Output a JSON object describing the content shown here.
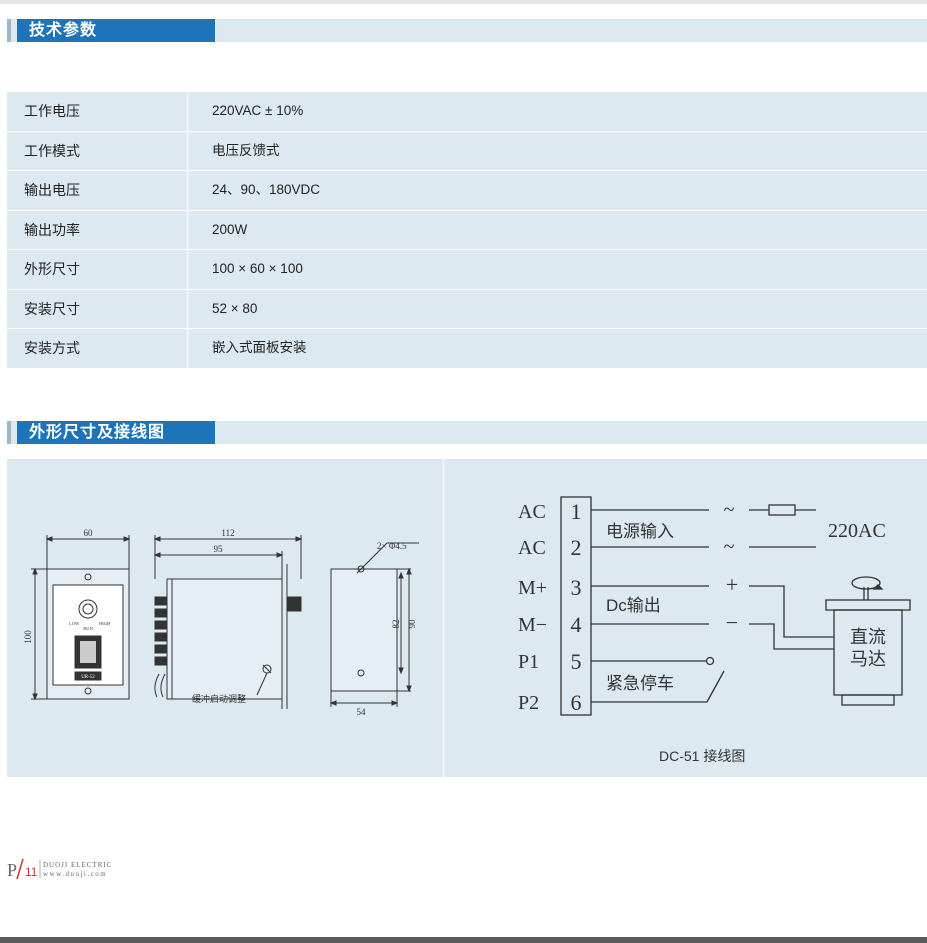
{
  "section1": {
    "title": "技术参数"
  },
  "specs": [
    {
      "k": "工作电压",
      "v": "220VAC ± 10%"
    },
    {
      "k": "工作模式",
      "v": "电压反馈式"
    },
    {
      "k": "输出电压",
      "v": "24、90、180VDC"
    },
    {
      "k": "输出功率",
      "v": "200W"
    },
    {
      "k": "外形尺寸",
      "v": "100 × 60 × 100"
    },
    {
      "k": "安装尺寸",
      "v": "52 × 80"
    },
    {
      "k": "安装方式",
      "v": "嵌入式面板安装"
    }
  ],
  "section2": {
    "title": "外形尺寸及接线图"
  },
  "dims": {
    "front_width": "60",
    "front_height": "100",
    "side_total": "112",
    "side_body": "95",
    "hole": "2× Φ4.5",
    "rear_h1": "82",
    "rear_h2": "90",
    "rear_w": "54",
    "note": "缓冲启动调整",
    "knob_low": "LOW",
    "knob_high": "HIGH",
    "knob_run": "RUN",
    "switch_label": "UR-52"
  },
  "wiring": {
    "terminals": [
      {
        "name": "AC",
        "num": "1"
      },
      {
        "name": "AC",
        "num": "2"
      },
      {
        "name": "M+",
        "num": "3"
      },
      {
        "name": "M−",
        "num": "4"
      },
      {
        "name": "P1",
        "num": "5"
      },
      {
        "name": "P2",
        "num": "6"
      }
    ],
    "power_input": "电源输入",
    "ac_value": "220AC",
    "dc_output": "Dc输出",
    "plus": "+",
    "minus": "−",
    "tilde": "~",
    "motor_line1": "直流",
    "motor_line2": "马达",
    "estop": "紧急停车",
    "caption": "DC-51  接线图"
  },
  "footer": {
    "page_p": "P",
    "page_num": "11",
    "brand": "DUOJI ELECTRIC",
    "url": "www.duoji.com"
  }
}
